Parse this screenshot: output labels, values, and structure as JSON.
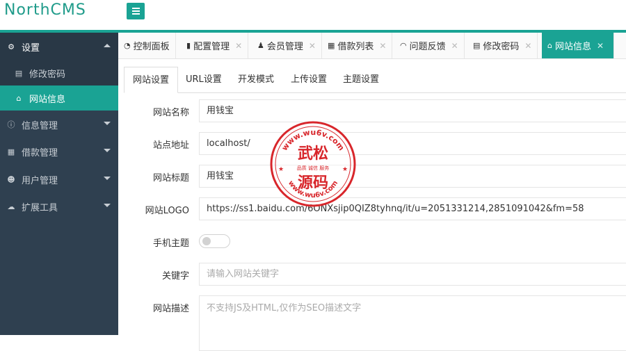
{
  "app": {
    "logo": "NorthCMS",
    "accent": "#1aa394",
    "sidebar_bg": "#2f4050"
  },
  "sidebar": {
    "items": [
      {
        "label": "设置",
        "icon": "gears-icon",
        "open": true
      },
      {
        "label": "信息管理",
        "icon": "info-icon"
      },
      {
        "label": "借款管理",
        "icon": "calendar-icon"
      },
      {
        "label": "用户管理",
        "icon": "users-icon"
      },
      {
        "label": "扩展工具",
        "icon": "cloud-icon"
      }
    ],
    "subitems": [
      {
        "label": "修改密码",
        "icon": "id-card-icon"
      },
      {
        "label": "网站信息",
        "icon": "home-icon",
        "active": true
      }
    ]
  },
  "tabs": [
    {
      "label": "控制面板",
      "icon": "dashboard-icon",
      "closable": false
    },
    {
      "label": "配置管理",
      "icon": "book-icon",
      "closable": true
    },
    {
      "label": "会员管理",
      "icon": "user-icon",
      "closable": true
    },
    {
      "label": "借款列表",
      "icon": "calendar-icon",
      "closable": true
    },
    {
      "label": "问题反馈",
      "icon": "rss-icon",
      "closable": true
    },
    {
      "label": "修改密码",
      "icon": "id-card-icon",
      "closable": true
    },
    {
      "label": "网站信息",
      "icon": "home-icon",
      "closable": true,
      "active": true
    }
  ],
  "close_glyph": "✕",
  "subtabs": [
    "网站设置",
    "URL设置",
    "开发模式",
    "上传设置",
    "主题设置"
  ],
  "form": {
    "site_name": {
      "label": "网站名称",
      "value": "用钱宝"
    },
    "site_url": {
      "label": "站点地址",
      "value": "localhost/"
    },
    "site_title": {
      "label": "网站标题",
      "value": "用钱宝"
    },
    "site_logo": {
      "label": "网站LOGO",
      "value": "https://ss1.baidu.com/6ONXsjip0QIZ8tyhnq/it/u=2051331214,2851091042&fm=58"
    },
    "mobile_theme": {
      "label": "手机主题",
      "on": false
    },
    "keywords": {
      "label": "关键字",
      "placeholder": "请输入网站关键字"
    },
    "description": {
      "label": "网站描述",
      "placeholder": "不支持JS及HTML,仅作为SEO描述文字"
    }
  },
  "watermark": {
    "url": "www.wu6v.com",
    "name_top": "武松",
    "tagline": "品质 诚信 服务",
    "name_bottom": "源码",
    "color": "#d8262b"
  }
}
